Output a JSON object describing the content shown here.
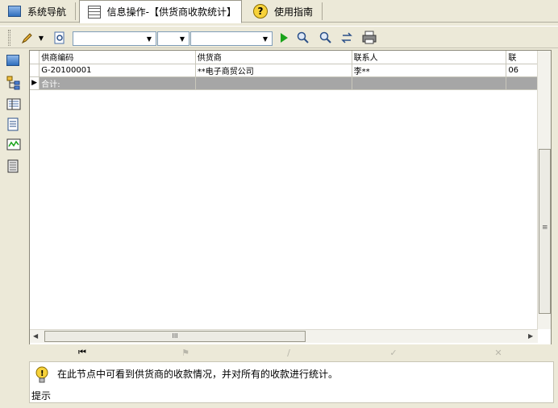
{
  "tabs": [
    {
      "label": "系统导航",
      "icon": "nav-blue-icon"
    },
    {
      "label": "信息操作-【供货商收款统计】",
      "icon": "grid-doc-icon"
    },
    {
      "label": "使用指南",
      "icon": "help-icon"
    }
  ],
  "toolbar": {
    "combo1_value": "",
    "combo2_value": "",
    "combo3_value": ""
  },
  "grid": {
    "columns": [
      "供商编码",
      "供货商",
      "联系人",
      "联"
    ],
    "rows": [
      [
        "G-20100001",
        "**电子商贸公司",
        "李**",
        "06"
      ]
    ],
    "summary_label": "合计:",
    "hscroll_grip": "III",
    "vscroll_grip": "≡"
  },
  "hint": {
    "label": "提示",
    "text": "在此节点中可看到供货商的收款情况，并对所有的收款进行统计。"
  },
  "colors": {
    "summary_row": "#a6a6a6",
    "run_button": "#1aa31a"
  }
}
